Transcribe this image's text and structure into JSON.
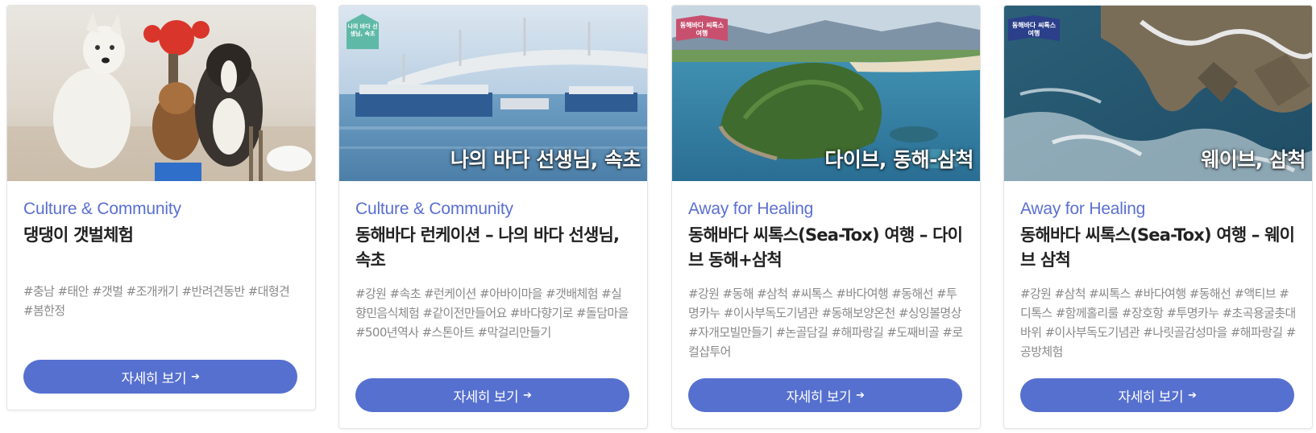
{
  "cards": [
    {
      "image_alt": "Dogs on tidal flat with crab toy",
      "overlay": "",
      "category": "Culture & Community",
      "title": "댕댕이 갯벌체험",
      "tags": "#충남 #태안 #갯벌 #조개캐기 #반려견동반 #대형견 #봄한정",
      "button_label": "자세히 보기",
      "button_icon": "arrow-right-icon"
    },
    {
      "image_alt": "Tour boats by bridge",
      "overlay": "나의 바다 선생님, 속초",
      "badge": "나의 바다 선생님, 속초",
      "category": "Culture & Community",
      "title": "동해바다 런케이션 – 나의 바다 선생님, 속초",
      "tags": "#강원 #속초 #런케이션 #아바이마을 #갯배체험 #실향민음식체험 #같이전만들어요 #바다향기로 #돌담마을 #500년역사 #스톤아트 #막걸리만들기",
      "button_label": "자세히 보기",
      "button_icon": "arrow-right-icon"
    },
    {
      "image_alt": "Aerial view of green island and sea",
      "overlay": "다이브, 동해-삼척",
      "badge": "동해바다 씨톡스 여행",
      "category": "Away for Healing",
      "title": "동해바다 씨톡스(Sea-Tox) 여행 – 다이브 동해+삼척",
      "tags": "#강원 #동해 #삼척 #씨톡스 #바다여행 #동해선 #투명카누 #이사부독도기념관 #동해보양온천 #싱잉볼명상 #자개모빌만들기 #논골담길 #해파랑길 #도째비골 #로컬샵투어",
      "button_label": "자세히 보기",
      "button_icon": "arrow-right-icon"
    },
    {
      "image_alt": "Coastal cliff walkway with waves",
      "overlay": "웨이브, 삼척",
      "badge": "동해바다 씨톡스 여행",
      "category": "Away for Healing",
      "title": "동해바다 씨톡스(Sea-Tox) 여행 – 웨이브 삼척",
      "tags": "#강원 #삼척 #씨톡스 #바다여행 #동해선 #액티브 #디톡스 #함께홀리룰 #장호항 #투명카누 #초곡용굴촛대바위 #이사부독도기념관 #나릿골감성마을 #해파랑길 #공방체험",
      "button_label": "자세히 보기",
      "button_icon": "arrow-right-icon"
    }
  ],
  "colors": {
    "accent": "#5670cf",
    "category": "#5b6fd0",
    "title": "#222222",
    "tags": "#8a8a8a"
  }
}
